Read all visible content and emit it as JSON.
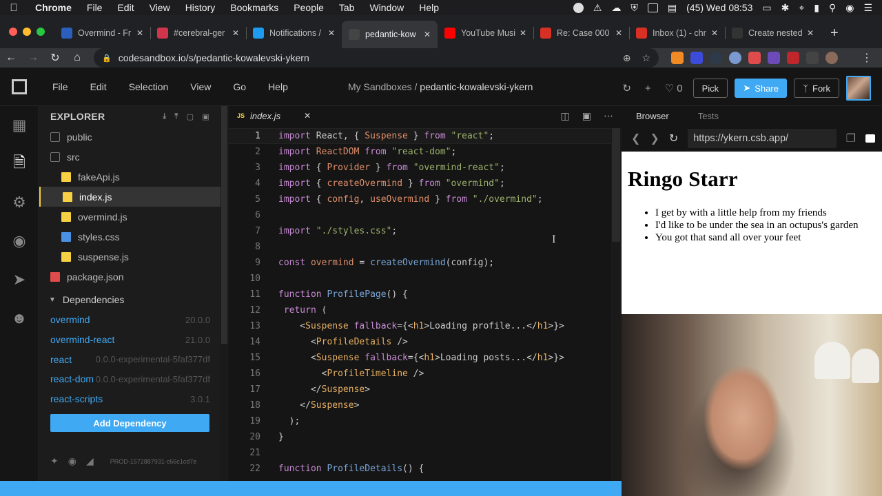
{
  "menubar": {
    "app": "Chrome",
    "items": [
      "File",
      "Edit",
      "View",
      "History",
      "Bookmarks",
      "People",
      "Tab",
      "Window",
      "Help"
    ],
    "clock": "(45) Wed 08:53"
  },
  "tabs": [
    {
      "title": "Overmind - Fr",
      "color": "#2a5fbd"
    },
    {
      "title": "#cerebral-ger",
      "color": "#d0354b"
    },
    {
      "title": "Notifications /",
      "color": "#1d9bf0"
    },
    {
      "title": "pedantic-kow",
      "color": "#444444",
      "active": true
    },
    {
      "title": "YouTube Musi",
      "color": "#ff0000"
    },
    {
      "title": "Re: Case 000",
      "color": "#d93025"
    },
    {
      "title": "Inbox (1) - chr",
      "color": "#d93025"
    },
    {
      "title": "Create nested",
      "color": "#333333"
    }
  ],
  "address": {
    "url": "codesandbox.io/s/pedantic-kowalevski-ykern"
  },
  "csb": {
    "menu": [
      "File",
      "Edit",
      "Selection",
      "View",
      "Go",
      "Help"
    ],
    "title_prefix": "My Sandboxes / ",
    "title_name": "pedantic-kowalevski-ykern",
    "likes": "0",
    "pick": "Pick",
    "share": "Share",
    "fork": "Fork"
  },
  "explorer": {
    "heading": "EXPLORER",
    "files": [
      {
        "name": "public",
        "type": "folder",
        "indent": 1
      },
      {
        "name": "src",
        "type": "folder-open",
        "indent": 1
      },
      {
        "name": "fakeApi.js",
        "type": "js",
        "indent": 2
      },
      {
        "name": "index.js",
        "type": "js",
        "indent": 2,
        "active": true
      },
      {
        "name": "overmind.js",
        "type": "js",
        "indent": 2
      },
      {
        "name": "styles.css",
        "type": "css",
        "indent": 2
      },
      {
        "name": "suspense.js",
        "type": "js",
        "indent": 2
      },
      {
        "name": "package.json",
        "type": "json",
        "indent": 1
      }
    ],
    "deps_heading": "Dependencies",
    "dependencies": [
      {
        "name": "overmind",
        "version": "20.0.0"
      },
      {
        "name": "overmind-react",
        "version": "21.0.0"
      },
      {
        "name": "react",
        "version": "0.0.0-experimental-5faf377df"
      },
      {
        "name": "react-dom",
        "version": "0.0.0-experimental-5faf377df"
      },
      {
        "name": "react-scripts",
        "version": "3.0.1"
      }
    ],
    "add_dependency": "Add Dependency",
    "build_id": "PROD-1572887931-c66c1cd7e"
  },
  "editor": {
    "tab_name": "index.js",
    "tab_lang": "JS",
    "current_line": 1
  },
  "preview": {
    "tabs": [
      "Browser",
      "Tests"
    ],
    "url": "https://ykern.csb.app/",
    "heading": "Ringo Starr",
    "items": [
      "I get by with a little help from my friends",
      "I'd like to be under the sea in an octupus's garden",
      "You got that sand all over your feet"
    ]
  }
}
